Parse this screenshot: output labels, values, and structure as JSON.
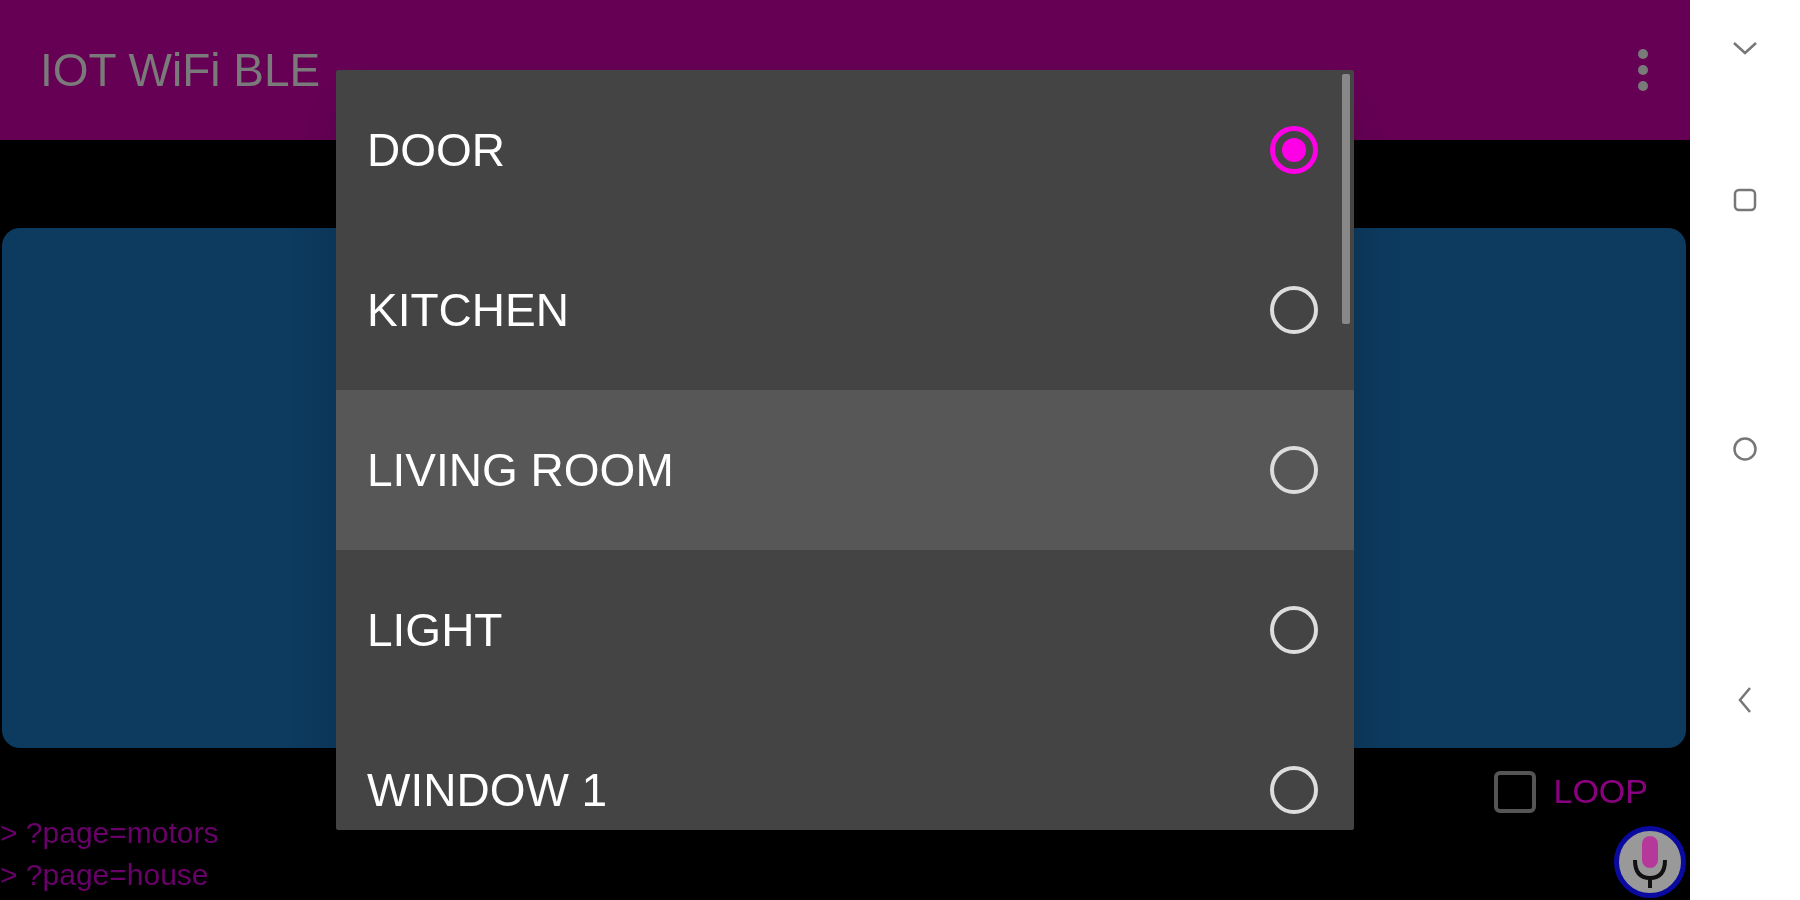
{
  "app_bar": {
    "title": "IOT WiFi BLE"
  },
  "dialog": {
    "items": [
      {
        "label": "DOOR",
        "selected": true,
        "highlighted": false
      },
      {
        "label": "KITCHEN",
        "selected": false,
        "highlighted": false
      },
      {
        "label": "LIVING ROOM",
        "selected": false,
        "highlighted": true
      },
      {
        "label": "LIGHT",
        "selected": false,
        "highlighted": false
      },
      {
        "label": "WINDOW 1",
        "selected": false,
        "highlighted": false
      }
    ]
  },
  "loop": {
    "label": "LOOP",
    "checked": false
  },
  "log": [
    "> ?page=motors",
    "> ?page=house"
  ]
}
